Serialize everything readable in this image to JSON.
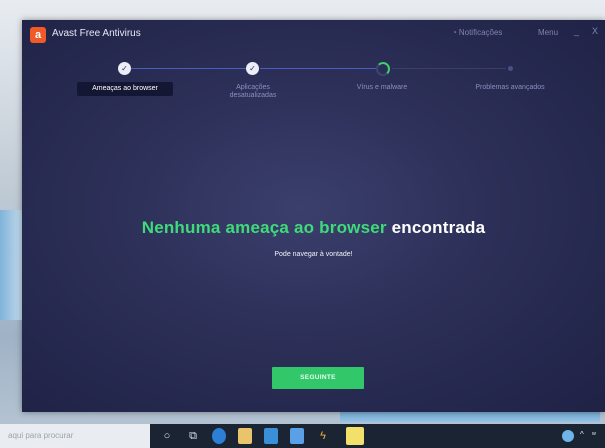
{
  "window": {
    "title": "Avast Free Antivirus",
    "notifications_label": "Notificações",
    "menu_label": "Menu",
    "minimize_symbol": "_",
    "close_symbol": "X"
  },
  "stepper": {
    "steps": [
      {
        "label": "Ameaças ao browser",
        "state": "done",
        "active": true
      },
      {
        "label": "Aplicações desatualizadas",
        "state": "done",
        "active": false
      },
      {
        "label": "Vírus e malware",
        "state": "current",
        "active": false
      },
      {
        "label": "Problemas avançados",
        "state": "pending",
        "active": false
      }
    ],
    "check_symbol": "✓"
  },
  "main": {
    "headline_green": "Nenhuma ameaça ao browser",
    "headline_white": "encontrada",
    "subtitle": "Pode navegar à vontade!",
    "next_button": "SEGUINTE"
  },
  "taskbar": {
    "search_placeholder": "aqui para procurar",
    "icons": [
      "cortana-icon",
      "task-view-icon",
      "edge-icon",
      "file-explorer-icon",
      "store-icon",
      "mail-icon",
      "winamp-icon",
      "app-icon"
    ]
  },
  "colors": {
    "accent_green": "#3fdb7b",
    "window_bg": "#2c2f57",
    "avast_orange": "#f05a28"
  }
}
